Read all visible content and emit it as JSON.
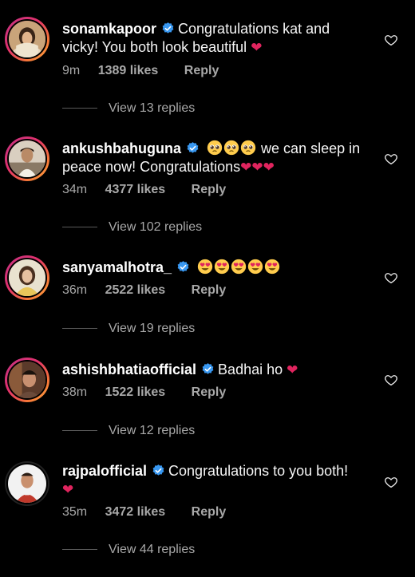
{
  "colors": {
    "background": "#000000",
    "verified": "#3897f0",
    "heart": "#e0245e",
    "meta_text": "#a8a8a8"
  },
  "comments": [
    {
      "username": "sonamkapoor",
      "verified": true,
      "text": "Congratulations kat and vicky! You both look beautiful",
      "trailing_emoji": "❤",
      "time": "9m",
      "likes": "1389 likes",
      "reply": "Reply",
      "view_replies": "View 13 replies",
      "avatar_icon": "avatar-sonamkapoor"
    },
    {
      "username": "ankushbahuguna",
      "verified": true,
      "leading_emoji": "🥺🥺🥺",
      "text": "we can sleep in peace now! Congratulations",
      "trailing_emoji": "❤❤❤",
      "time": "34m",
      "likes": "4377 likes",
      "reply": "Reply",
      "view_replies": "View 102 replies",
      "avatar_icon": "avatar-ankushbahuguna"
    },
    {
      "username": "sanyamalhotra_",
      "verified": true,
      "text": "",
      "trailing_emoji": "😍😍😍😍😍",
      "time": "36m",
      "likes": "2522 likes",
      "reply": "Reply",
      "view_replies": "View 19 replies",
      "avatar_icon": "avatar-sanyamalhotra"
    },
    {
      "username": "ashishbhatiaofficial",
      "verified": true,
      "text": "Badhai ho",
      "trailing_emoji": "❤",
      "time": "38m",
      "likes": "1522 likes",
      "reply": "Reply",
      "view_replies": "View 12 replies",
      "avatar_icon": "avatar-ashishbhatiaofficial"
    },
    {
      "username": "rajpalofficial",
      "verified": true,
      "text": "Congratulations to you both!",
      "trailing_emoji": "❤",
      "time": "35m",
      "likes": "3472 likes",
      "reply": "Reply",
      "view_replies": "View 44 replies",
      "avatar_icon": "avatar-rajpalofficial"
    }
  ]
}
